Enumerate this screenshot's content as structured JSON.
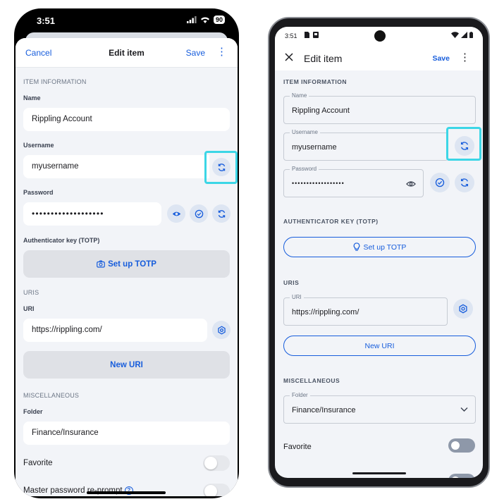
{
  "ios": {
    "status": {
      "time": "3:51",
      "battery": "90"
    },
    "nav": {
      "cancel": "Cancel",
      "title": "Edit item",
      "save": "Save"
    },
    "item_information": {
      "header": "ITEM INFORMATION",
      "name_label": "Name",
      "name_value": "Rippling Account",
      "username_label": "Username",
      "username_value": "myusername",
      "password_label": "Password",
      "password_value": "•••••••••••••••••••",
      "totp_label": "Authenticator key (TOTP)",
      "totp_button": "Set up TOTP"
    },
    "uris": {
      "header": "URIS",
      "uri_label": "URI",
      "uri_value": "https://rippling.com/",
      "new_uri_button": "New URI"
    },
    "misc": {
      "header": "MISCELLANEOUS",
      "folder_label": "Folder",
      "folder_value": "Finance/Insurance",
      "favorite_label": "Favorite",
      "reprompt_label": "Master password re-prompt"
    }
  },
  "android": {
    "status": {
      "time": "3:51"
    },
    "appbar": {
      "title": "Edit item",
      "save": "Save"
    },
    "item_information": {
      "header": "ITEM INFORMATION",
      "name_label": "Name",
      "name_value": "Rippling Account",
      "username_label": "Username",
      "username_value": "myusername",
      "password_label": "Password",
      "password_value": "••••••••••••••••••"
    },
    "totp": {
      "header": "AUTHENTICATOR KEY (TOTP)",
      "button": "Set up TOTP"
    },
    "uris": {
      "header": "URIS",
      "uri_label": "URI",
      "uri_value": "https://rippling.com/",
      "new_uri_button": "New URI"
    },
    "misc": {
      "header": "MISCELLANEOUS",
      "folder_label": "Folder",
      "folder_value": "Finance/Insurance",
      "favorite_label": "Favorite"
    }
  },
  "colors": {
    "accent": "#175ddc",
    "highlight": "#3cd6e6",
    "background": "#f2f4f8"
  }
}
